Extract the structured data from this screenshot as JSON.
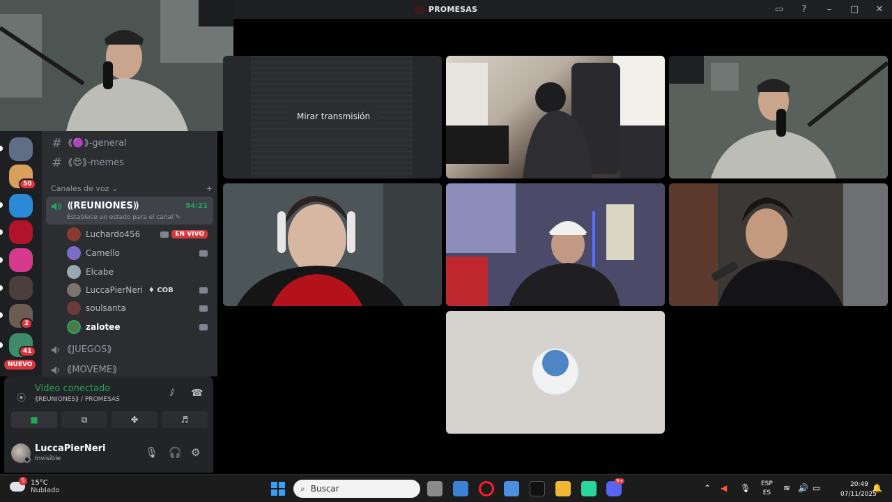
{
  "window": {
    "title": "PROMESAS"
  },
  "servers": [
    {
      "badge": ""
    },
    {
      "badge": "50"
    },
    {
      "badge": ""
    },
    {
      "badge": ""
    },
    {
      "badge": ""
    },
    {
      "badge": ""
    },
    {
      "badge": "2"
    },
    {
      "badge": "41"
    }
  ],
  "new_badge": "NUEVO",
  "channels": {
    "text": [
      {
        "label": "⟪🟣⟫-general"
      },
      {
        "label": "⟪😍⟫-memes"
      }
    ],
    "voice_category": "Canales de voz",
    "active_voice": {
      "name": "⟪REUNIONES⟫",
      "timer": "54:21",
      "status": "Establece un estado para el canal"
    },
    "members": [
      {
        "name": "Luchardo456",
        "live": "EN VIVO"
      },
      {
        "name": "Camello"
      },
      {
        "name": "Elcabe"
      },
      {
        "name": "LuccaPierNeri",
        "tag": "COB"
      },
      {
        "name": "soulsanta"
      },
      {
        "name": "zalotee"
      }
    ],
    "other_voice": [
      "⟪JUEGOS⟫",
      "⟪MOVEME⟫"
    ]
  },
  "voice_panel": {
    "status": "Video conectado",
    "location": "⟪REUNIONES⟫ / PROMESAS"
  },
  "user_panel": {
    "name": "LuccaPierNeri",
    "status": "Invisible"
  },
  "stream": {
    "button": "Mirar transmisión"
  },
  "taskbar": {
    "temp": "15°C",
    "weather": "Nublado",
    "weather_badge": "5",
    "search_placeholder": "Buscar",
    "discord_badge": "9+",
    "lang1": "ESP",
    "lang2": "ES",
    "time": "20:49",
    "date": "07/11/2025"
  },
  "colors": {
    "accent_green": "#23a55a",
    "live_red": "#da373c",
    "blurple": "#5865f2"
  }
}
